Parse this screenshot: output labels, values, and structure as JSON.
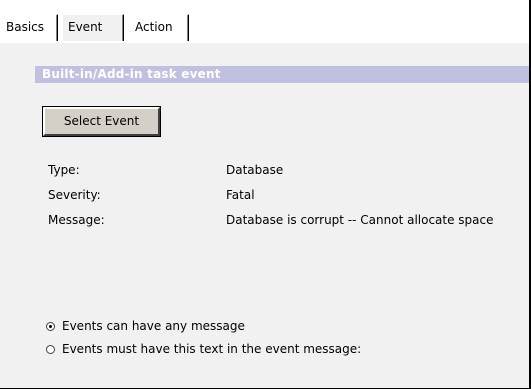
{
  "tabs": [
    {
      "label": "Basics",
      "active": false
    },
    {
      "label": "Event",
      "active": true
    },
    {
      "label": "Action",
      "active": false
    }
  ],
  "section": {
    "title": "Built-in/Add-in task event",
    "header_color": "#c0c0e0"
  },
  "select_event_button": "Select Event",
  "fields": {
    "type_label": "Type:",
    "type_value": "Database",
    "severity_label": "Severity:",
    "severity_value": "Fatal",
    "message_label": "Message:",
    "message_value": "Database is corrupt -- Cannot allocate space"
  },
  "radios": [
    {
      "label": "Events can have any message",
      "checked": true
    },
    {
      "label": "Events must have this text in the event message:",
      "checked": false
    }
  ]
}
